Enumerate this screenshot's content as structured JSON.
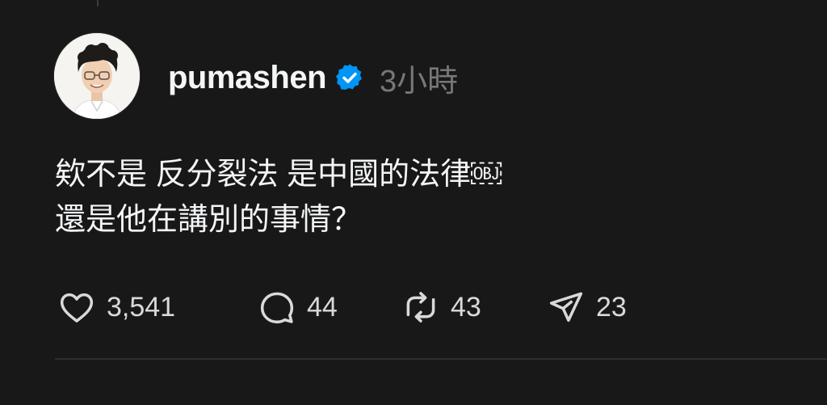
{
  "post": {
    "username": "pumashen",
    "verified": true,
    "time": "3小時",
    "text_lines": [
      "欸不是 反分裂法 是中國的法律￼",
      "還是他在講別的事情？"
    ]
  },
  "actions": {
    "likes": "3,541",
    "replies": "44",
    "reposts": "43",
    "shares": "23"
  },
  "icons": {
    "like": "heart-icon",
    "reply": "comment-icon",
    "repost": "repost-icon",
    "share": "send-icon",
    "verified": "verified-badge-icon"
  },
  "colors": {
    "background": "#181818",
    "text": "#f3f5f7",
    "muted": "#777777",
    "verified": "#0095f6"
  }
}
